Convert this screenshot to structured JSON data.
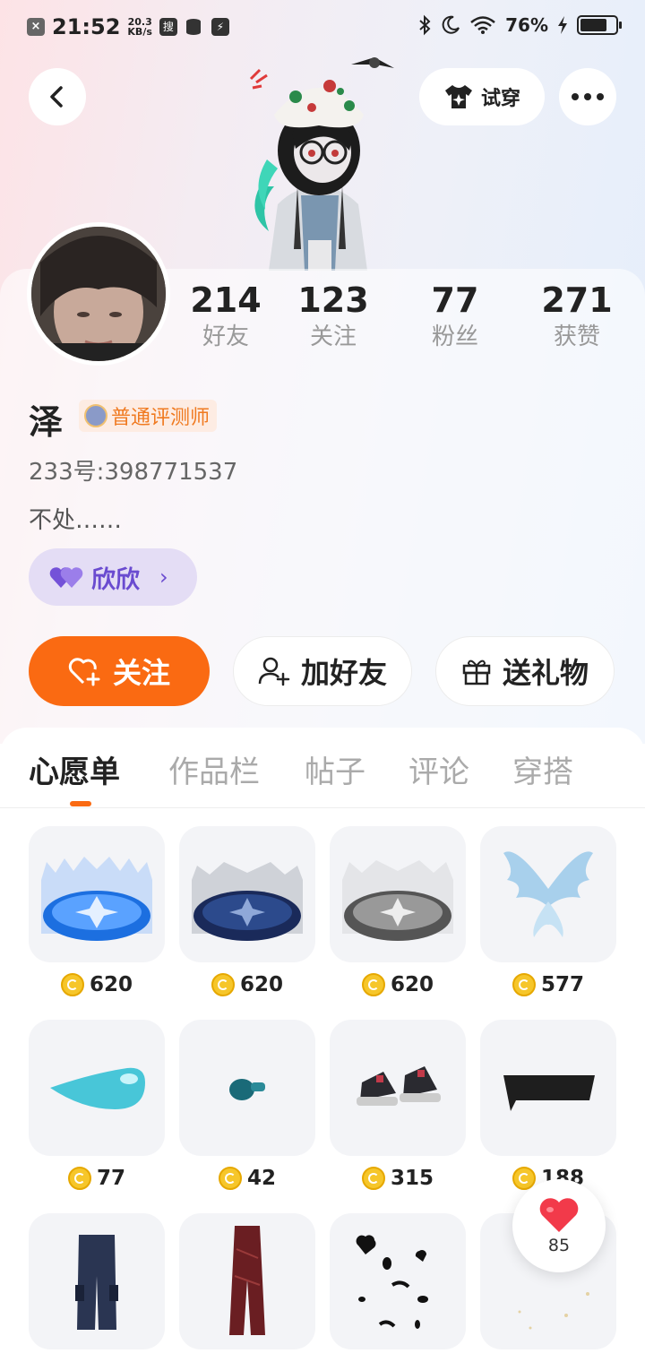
{
  "status_bar": {
    "time": "21:52",
    "speed_value": "20.3",
    "speed_unit": "KB/s",
    "app_icon_1": "搜",
    "battery": "76%",
    "battery_level": 0.76
  },
  "nav": {
    "back_icon": "chevron-left-icon",
    "try_on_label": "试穿",
    "more_icon": "more-dots-icon"
  },
  "profile": {
    "name": "泽",
    "badge": "普通评测师",
    "uid": "233号:398771537",
    "bio": "不处……",
    "cp_label": "欣欣",
    "stats": [
      {
        "value": "214",
        "label": "好友"
      },
      {
        "value": "123",
        "label": "关注"
      },
      {
        "value": "77",
        "label": "粉丝"
      },
      {
        "value": "271",
        "label": "获赞"
      }
    ]
  },
  "actions": {
    "follow": "关注",
    "add_friend": "加好友",
    "send_gift": "送礼物"
  },
  "tabs": [
    "心愿单",
    "作品栏",
    "帖子",
    "评论",
    "穿搭"
  ],
  "active_tab": 0,
  "wishlist": [
    {
      "item": "blue-snowflake-aura",
      "price": "620"
    },
    {
      "item": "dark-snowflake-aura",
      "price": "620"
    },
    {
      "item": "gray-snowflake-aura",
      "price": "620"
    },
    {
      "item": "ice-wings",
      "price": "577"
    },
    {
      "item": "cyan-droplet",
      "price": "77"
    },
    {
      "item": "teal-pacifier",
      "price": "42"
    },
    {
      "item": "sneakers",
      "price": "315"
    },
    {
      "item": "black-headband",
      "price": "188"
    },
    {
      "item": "dark-cargo-pants",
      "price": ""
    },
    {
      "item": "red-leather-pants",
      "price": ""
    },
    {
      "item": "black-heart-petals",
      "price": ""
    },
    {
      "item": "faint-sparkles",
      "price": ""
    }
  ],
  "like_button": {
    "count": "85"
  },
  "colors": {
    "accent": "#fa6a12",
    "cp_purple": "#6a4bd0",
    "coin": "#f6c62a"
  }
}
